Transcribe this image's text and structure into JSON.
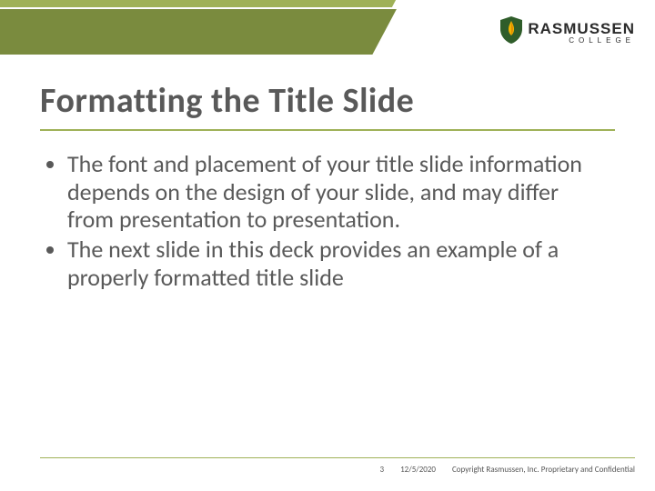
{
  "brand": {
    "name": "RASMUSSEN",
    "sub": "COLLEGE"
  },
  "slide": {
    "title": "Formatting the Title Slide",
    "bullets": [
      "The font and placement of your title slide information depends on the design of your slide, and may differ from presentation to presentation.",
      "The next slide in this deck provides an example of a properly formatted title slide"
    ]
  },
  "footer": {
    "page": "3",
    "date": "12/5/2020",
    "copyright": "Copyright Rasmussen, Inc. Proprietary and Confidential"
  }
}
